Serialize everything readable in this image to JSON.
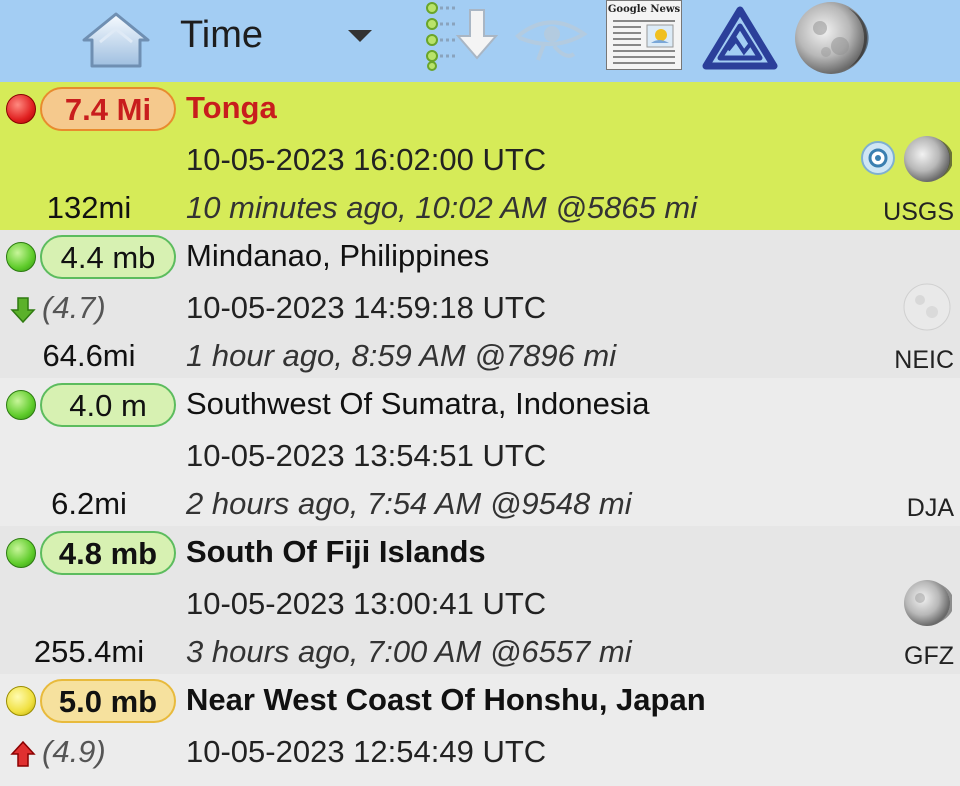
{
  "toolbar": {
    "sort_label": "Time",
    "news_title": "Google News",
    "icons": [
      "home-icon",
      "filter-list-icon",
      "eye-icon",
      "news-icon",
      "quake-app-icon",
      "moon-icon"
    ]
  },
  "colors": {
    "toolbar_bg": "#a3cdf3",
    "highlight_row": "#d6eb58",
    "alert_red": "#c81d1d"
  },
  "quakes": [
    {
      "magnitude": "7.4 Mi",
      "place": "Tonga",
      "utc": "10-05-2023 16:02:00 UTC",
      "relative": "10 minutes ago, 10:02 AM @5865 mi",
      "depth": "132mi",
      "source": "USGS",
      "previous": "",
      "level": "red"
    },
    {
      "magnitude": "4.4 mb",
      "place": "Mindanao, Philippines",
      "utc": "10-05-2023 14:59:18 UTC",
      "relative": "1 hour ago, 8:59 AM @7896 mi",
      "depth": "64.6mi",
      "source": "NEIC",
      "previous": "(4.7)",
      "level": "green"
    },
    {
      "magnitude": "4.0 m",
      "place": "Southwest Of Sumatra, Indonesia",
      "utc": "10-05-2023 13:54:51 UTC",
      "relative": "2 hours ago, 7:54 AM @9548 mi",
      "depth": "6.2mi",
      "source": "DJA",
      "previous": "",
      "level": "green"
    },
    {
      "magnitude": "4.8 mb",
      "place": "South Of Fiji Islands",
      "utc": "10-05-2023 13:00:41 UTC",
      "relative": "3 hours ago, 7:00 AM @6557 mi",
      "depth": "255.4mi",
      "source": "GFZ",
      "previous": "",
      "level": "green"
    },
    {
      "magnitude": "5.0 mb",
      "place": "Near West Coast Of Honshu, Japan",
      "utc": "10-05-2023 12:54:49 UTC",
      "relative": "",
      "depth": "",
      "source": "",
      "previous": "(4.9)",
      "level": "yellow"
    }
  ]
}
